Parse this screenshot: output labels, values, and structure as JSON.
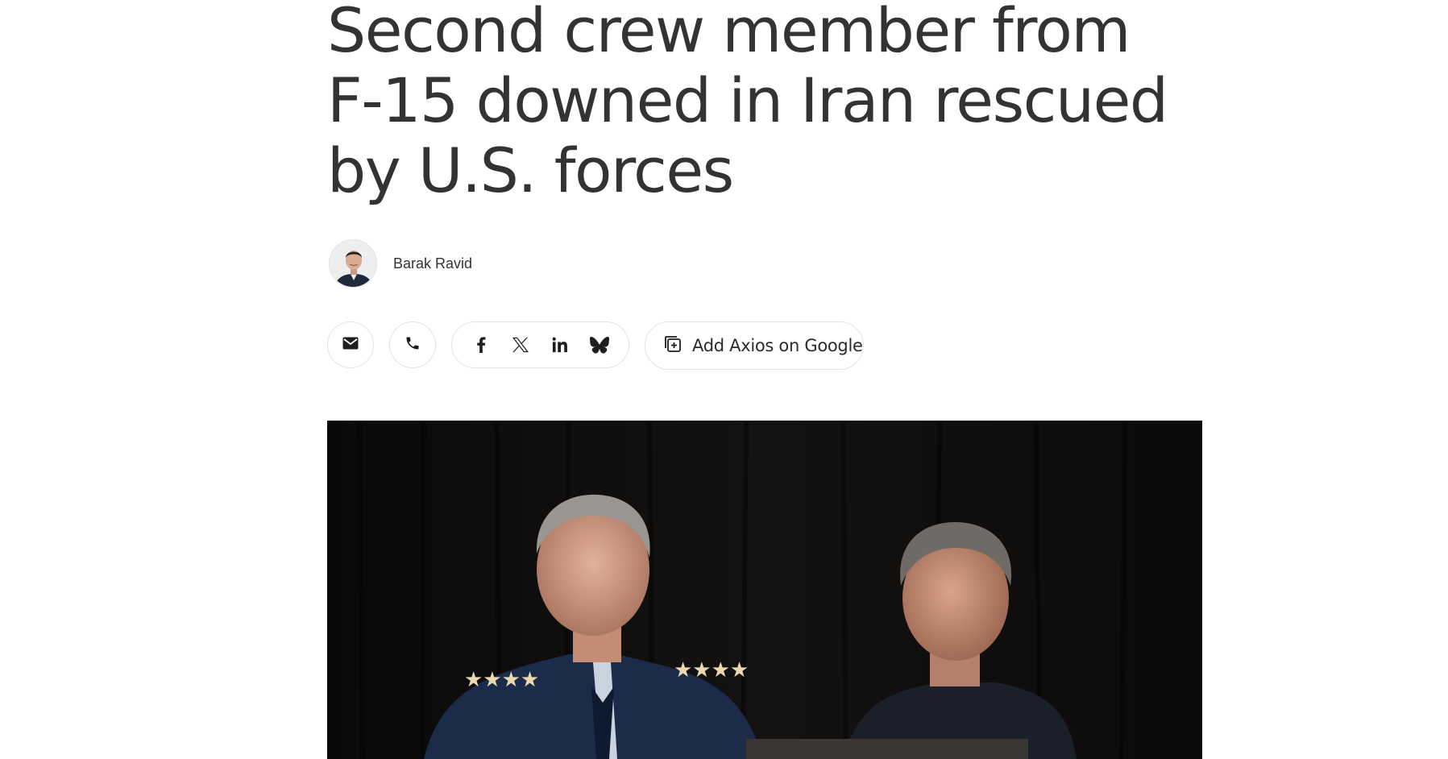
{
  "article": {
    "headline": "Second crew member from F-15 downed in Iran rescued by U.S. forces",
    "author": {
      "name": "Barak Ravid"
    }
  },
  "share": {
    "email_icon": "envelope-icon",
    "phone_icon": "phone-icon",
    "social": [
      "facebook-icon",
      "x-icon",
      "linkedin-icon",
      "bluesky-icon"
    ],
    "google_button_label": "Add Axios on Google",
    "google_icon": "add-source-icon"
  },
  "hero_image": {
    "description_icon": "photo"
  },
  "colors": {
    "text": "#333333",
    "border": "#e4e4e4",
    "hero_bg": "#0c0b0b"
  }
}
